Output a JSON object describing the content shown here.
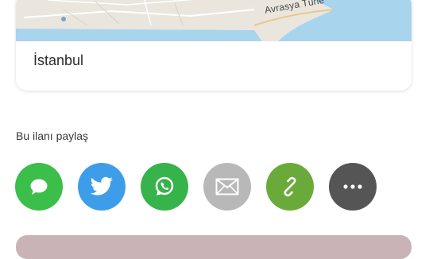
{
  "location_card": {
    "map_street_label": "Avrasya Tüne",
    "city": "İstanbul"
  },
  "share": {
    "title": "Bu ilanı paylaş",
    "buttons": [
      {
        "name": "sms-share-button",
        "icon": "message-bubble-icon",
        "color": "#3bbf4a"
      },
      {
        "name": "twitter-share-button",
        "icon": "twitter-bird-icon",
        "color": "#3e9de8"
      },
      {
        "name": "whatsapp-share-button",
        "icon": "whatsapp-icon",
        "color": "#36b34a"
      },
      {
        "name": "email-share-button",
        "icon": "envelope-icon",
        "color": "#b8b8b8"
      },
      {
        "name": "copy-link-share-button",
        "icon": "link-icon",
        "color": "#6aaa3a"
      },
      {
        "name": "more-share-button",
        "icon": "more-dots-icon",
        "color": "#555555"
      }
    ]
  },
  "colors": {
    "map_land": "#eae6de",
    "map_water": "#a9d4ee",
    "bottom_button": "#c9b3b6"
  }
}
